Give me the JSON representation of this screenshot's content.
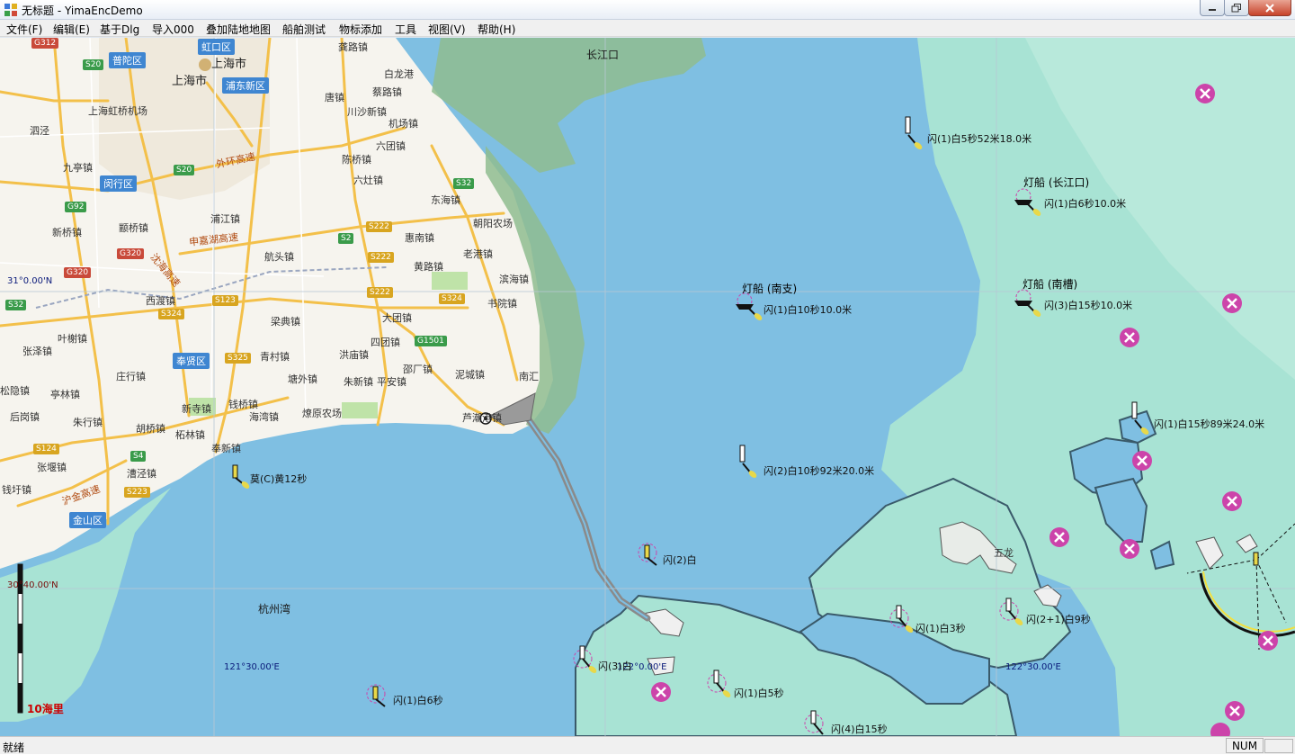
{
  "window": {
    "title": "无标题 - YimaEncDemo"
  },
  "menu": [
    "文件(F)",
    "编辑(E)",
    "基于Dlg",
    "导入000",
    "叠加陆地地图",
    "船舶测试",
    "物标添加",
    "工具",
    "视图(V)",
    "帮助(H)"
  ],
  "status": {
    "text": "就绪",
    "num": "NUM"
  },
  "colors": {
    "sea_deep": "#7fbfe2",
    "sea_shallow": "#a8e3d4",
    "land": "#f6f4ee",
    "road": "#f3c04a",
    "buoy_symbol": "#cc44aa"
  },
  "map": {
    "water_labels": {
      "yangtze": "长江口",
      "hangzhou_bay": "杭州湾"
    },
    "coords": {
      "lat_31": "31°0.00'N",
      "lat_30_40": "30°40.00'N",
      "lon_121_30": "121°30.00'E",
      "lon_122": "122°0.00'E",
      "lon_122_30": "122°30.00'E"
    },
    "scale_label": "10海里",
    "lightships": [
      {
        "name": "灯船 (长江口)",
        "light": "闪(1)白6秒10.0米"
      },
      {
        "name": "灯船 (南支)",
        "light": "闪(1)白10秒10.0米"
      },
      {
        "name": "灯船 (南槽)",
        "light": "闪(3)白15秒10.0米"
      }
    ],
    "lights": [
      "闪(1)白5秒52米18.0米",
      "闪(1)白15秒89米24.0米",
      "闪(2)白10秒92米20.0米",
      "莫(C)黄12秒",
      "闪(2)白",
      "闪(1)白3秒",
      "闪(2+1)白9秒",
      "闪(3)白",
      "闪(1)白5秒",
      "闪(4)白15秒",
      "闪(1)白6秒"
    ],
    "island_label": "五龙",
    "district_labels": [
      "虹口区",
      "普陀区",
      "浦东新区",
      "闵行区",
      "奉贤区",
      "金山区"
    ],
    "city_labels": [
      "上海市",
      "上海市"
    ],
    "town_labels": [
      "龚路镇",
      "白龙港",
      "唐镇",
      "蔡路镇",
      "川沙新镇",
      "机场镇",
      "六团镇",
      "陈桥镇",
      "六灶镇",
      "东海镇",
      "浦江镇",
      "惠南镇",
      "老港镇",
      "航头镇",
      "黄路镇",
      "滨海镇",
      "书院镇",
      "西渡镇",
      "大团镇",
      "梁典镇",
      "四团镇",
      "青村镇",
      "洪庙镇",
      "塘外镇",
      "朱新镇",
      "平安镇",
      "泥城镇",
      "南汇",
      "钱桥镇",
      "海湾镇",
      "燎原农场",
      "芦潮港镇",
      "新寺镇",
      "朱行镇",
      "胡桥镇",
      "柘林镇",
      "奉新镇",
      "漕泾镇",
      "九亭镇",
      "颛桥镇",
      "新桥镇",
      "庄行镇",
      "亭林镇",
      "叶榭镇",
      "张泽镇",
      "后岗镇",
      "张堰镇",
      "钱圩镇",
      "上海虹桥机场",
      "朝阳农场",
      "邵厂镇",
      "泗泾",
      "松隐镇"
    ],
    "road_labels": [
      "外环高速",
      "申嘉湖高速",
      "沈海高速",
      "沪金高速"
    ],
    "shield_labels": [
      "S20",
      "S20",
      "G92",
      "G320",
      "G320",
      "S32",
      "S32",
      "S2",
      "S222",
      "S222",
      "S222",
      "S123",
      "S324",
      "S324",
      "G1501",
      "S325",
      "S124",
      "S4",
      "S223",
      "G312"
    ]
  }
}
